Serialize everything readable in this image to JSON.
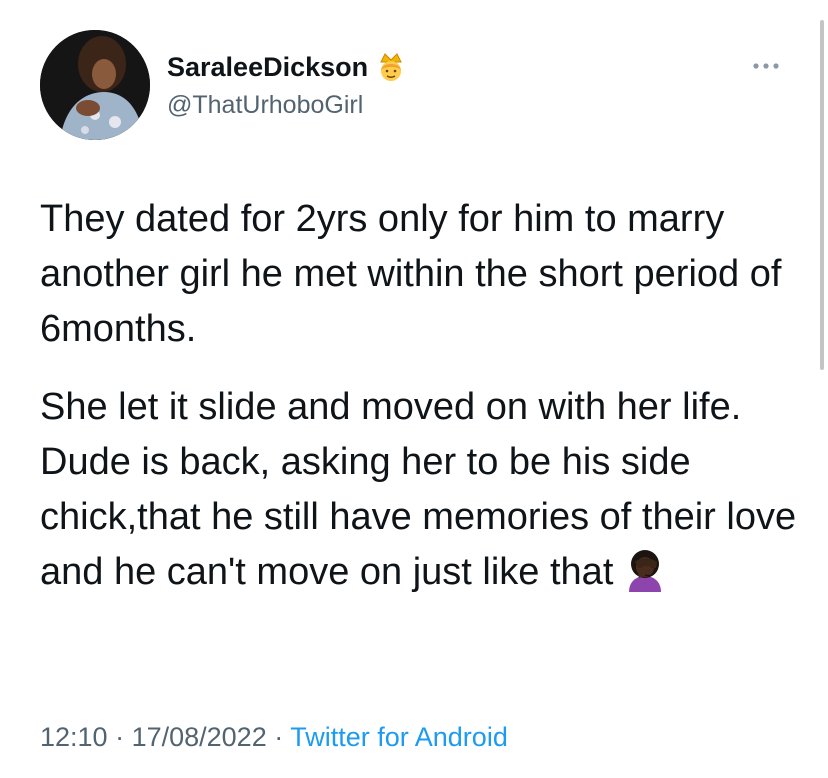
{
  "author": {
    "display_name": "SaraleeDickson",
    "handle": "@ThatUrhoboGirl",
    "avatar_icon": "profile-photo",
    "badge_icon": "crown-emoji-icon"
  },
  "tweet": {
    "paragraphs": [
      "They dated for 2yrs only for him to marry another girl he met within the short period of 6months.",
      "She let it slide and moved on with her life. Dude is back, asking her to be his side chick,that he still have memories of their love and he can't move on just like that"
    ],
    "trailing_emoji_icon": "facepalm-emoji-icon"
  },
  "meta": {
    "time": "12:10",
    "separator": " · ",
    "date": "17/08/2022",
    "source": "Twitter for Android"
  },
  "colors": {
    "text": "#0f1419",
    "secondary": "#536471",
    "link": "#1d9bf0"
  }
}
